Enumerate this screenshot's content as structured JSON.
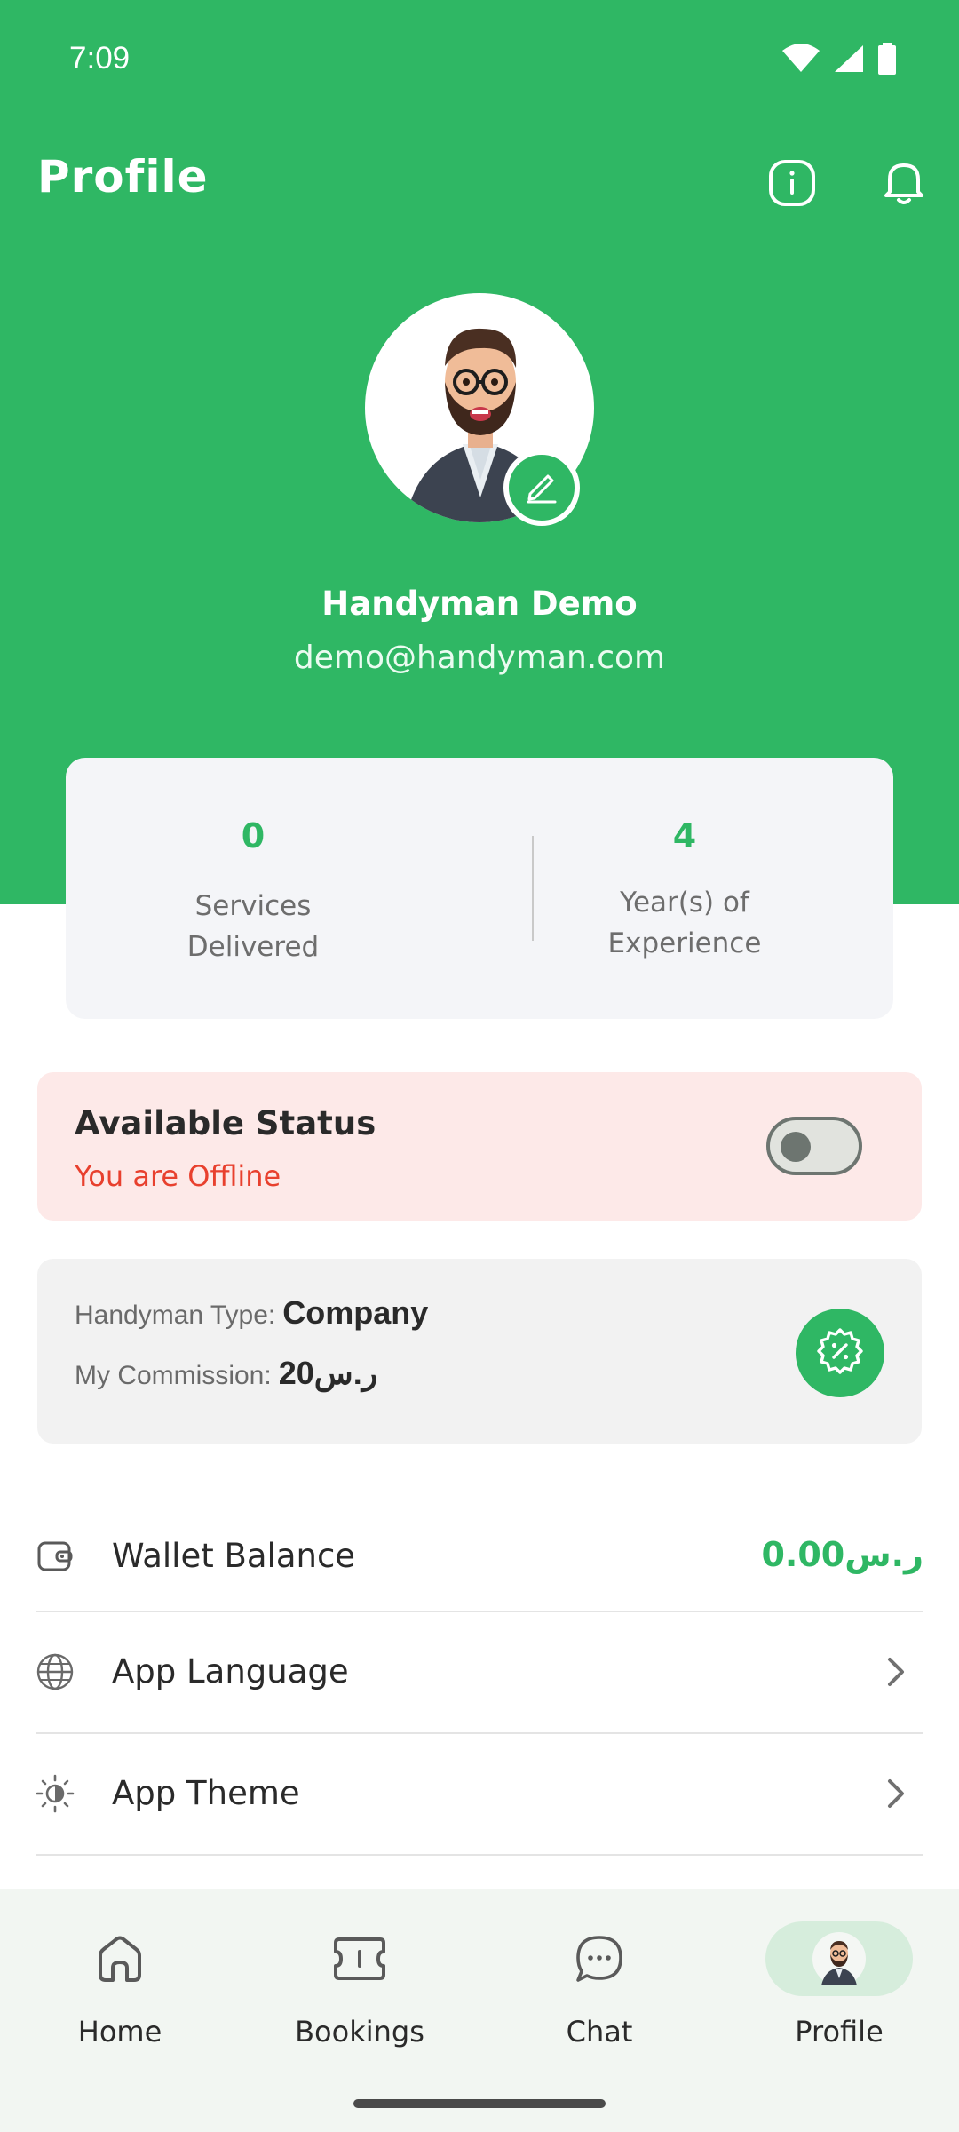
{
  "status_bar": {
    "time": "7:09",
    "icons": [
      "wifi-icon",
      "signal-icon",
      "battery-icon"
    ]
  },
  "header": {
    "title": "Profile",
    "actions": [
      {
        "name": "info-icon"
      },
      {
        "name": "bell-icon"
      }
    ]
  },
  "profile": {
    "name": "Handyman Demo",
    "email": "demo@handyman.com"
  },
  "stats": {
    "services_value": "0",
    "services_label_1": "Services",
    "services_label_2": "Delivered",
    "experience_value": "4",
    "experience_label_1": "Year(s) of",
    "experience_label_2": "Experience"
  },
  "availability": {
    "title": "Available Status",
    "subtitle": "You are Offline",
    "is_online": false
  },
  "handyman_info": {
    "type_label": "Handyman Type:",
    "type_value": "Company",
    "commission_label": "My Commission:",
    "commission_value": "20ر.س"
  },
  "settings": {
    "wallet_label": "Wallet Balance",
    "wallet_value": "0.00ر.س",
    "language_label": "App Language",
    "theme_label": "App Theme"
  },
  "bottom_nav": {
    "items": [
      {
        "label": "Home",
        "icon": "home-icon"
      },
      {
        "label": "Bookings",
        "icon": "ticket-icon"
      },
      {
        "label": "Chat",
        "icon": "chat-icon"
      },
      {
        "label": "Profile",
        "icon": "avatar-icon",
        "active": true
      }
    ]
  },
  "colors": {
    "brand_green": "#2fb764",
    "offline_red": "#e8402e",
    "offline_bg": "#fde9e8"
  }
}
